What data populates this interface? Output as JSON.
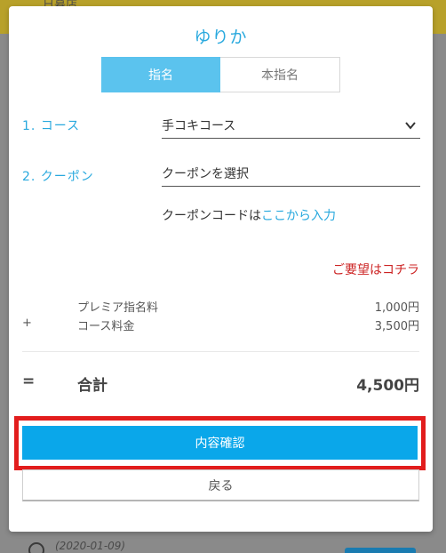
{
  "backdrop": {
    "header_text": "日暮店",
    "date_text": "(2020-01-09)"
  },
  "modal": {
    "title": "ゆりか",
    "tabs": [
      {
        "label": "指名",
        "active": true
      },
      {
        "label": "本指名",
        "active": false
      }
    ],
    "course": {
      "label": "1. コース",
      "selected": "手コキコース",
      "icon": "chevron-down-icon"
    },
    "coupon": {
      "label": "2. クーポン",
      "selected": "クーポンを選択",
      "code_prefix": "クーポンコードは",
      "code_link": "ここから入力"
    },
    "request_link": "ご要望はコチラ",
    "fees": [
      {
        "sign": "",
        "name": "プレミア指名料",
        "value": "1,000円"
      },
      {
        "sign": "+",
        "name": "コース料金",
        "value": "3,500円"
      }
    ],
    "total": {
      "sign": "=",
      "name": "合計",
      "value": "4,500円"
    },
    "confirm_label": "内容確認",
    "back_label": "戻る"
  },
  "colors": {
    "accent": "#29a9de",
    "tab_active": "#5bc3ee",
    "confirm_button": "#0aa7ea",
    "highlight_frame": "#e21d1d",
    "request_link": "#cc2222"
  }
}
